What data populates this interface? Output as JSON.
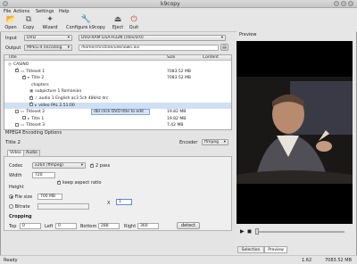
{
  "window": {
    "title": "k9copy"
  },
  "menu": [
    "File",
    "Actions",
    "Settings",
    "Help"
  ],
  "toolbar": [
    {
      "label": "Open",
      "icon": "folder-open-icon",
      "glyph": "📂"
    },
    {
      "label": "Copy",
      "icon": "copy-icon",
      "glyph": "⧉"
    },
    {
      "label": "Wizard",
      "icon": "wizard-icon",
      "glyph": "✦"
    },
    {
      "label": "Configure k9copy",
      "icon": "configure-icon",
      "glyph": "🔧"
    },
    {
      "label": "Eject",
      "icon": "eject-icon",
      "glyph": "⏏"
    },
    {
      "label": "Quit",
      "icon": "quit-icon",
      "glyph": "⏻"
    }
  ],
  "input": {
    "label": "Input",
    "type": "DVD",
    "device": "DVD-RAM GSA-H32N  (/dev/sr0)"
  },
  "output": {
    "label": "Output",
    "format": "MPEG-4 encoding",
    "path": "/home/christine/unknown.avi"
  },
  "tree": {
    "headers": [
      "Title",
      "Size",
      "Content"
    ],
    "rows": [
      {
        "text": "CASINO",
        "size": "",
        "level": 0,
        "check": false,
        "icon": "disc-icon"
      },
      {
        "text": "Titleset 1",
        "size": "7083.52 MB",
        "level": 1,
        "check": true,
        "icon": "folder-icon"
      },
      {
        "text": "Title 2",
        "size": "7083.52 MB",
        "level": 2,
        "check": true,
        "icon": "video-icon"
      },
      {
        "text": "chapters",
        "size": "",
        "level": 3,
        "check": false,
        "icon": ""
      },
      {
        "text": "subpicture 1 Romanian",
        "size": "",
        "level": 3,
        "check": false,
        "icon": "subtitle-icon"
      },
      {
        "text": "audio 1 English ac3 5ch 48kHz drc",
        "size": "",
        "level": 3,
        "check": true,
        "icon": "audio-icon"
      },
      {
        "text": "video PAL    2.51:00",
        "size": "",
        "level": 3,
        "check": true,
        "icon": "video-icon"
      },
      {
        "text": "Titleset 2",
        "size": "19.82 MB",
        "level": 1,
        "check": false,
        "icon": "folder-icon"
      },
      {
        "text": "Title 1",
        "size": "19.82 MB",
        "level": 2,
        "check": false,
        "icon": "video-icon"
      },
      {
        "text": "Titleset 3",
        "size": "7.42 MB",
        "level": 1,
        "check": false,
        "icon": "folder-icon"
      }
    ],
    "tooltip": "dbl click DVD title to edit"
  },
  "encoding": {
    "panel_title": "MPEG4 Encoding Options",
    "title_name": "Title 2",
    "encoder_label": "Encoder",
    "encoder": "ffmpeg",
    "tabs": [
      "Video",
      "Audio"
    ],
    "codec_label": "Codec",
    "codec": "x264 (ffmpeg)",
    "two_pass": "2 pass",
    "width_label": "Width",
    "width": "720",
    "keep_aspect": "keep aspect ratio",
    "height_label": "Height",
    "file_size_label": "File size",
    "file_size": "700 MB",
    "bitrate_label": "Bitrate",
    "x_label": "X",
    "x_value": "1",
    "cropping_label": "Cropping",
    "top_label": "Top",
    "top": "0",
    "left_label": "Left",
    "left": "0",
    "bottom_label": "Bottom",
    "bottom": "288",
    "right_label": "Right",
    "right": "360",
    "detect_label": "detect"
  },
  "preview": {
    "title": "Preview",
    "tabs": [
      "Selection",
      "Preview"
    ]
  },
  "status": {
    "left": "Ready",
    "value1": "1.62",
    "value2": "7083.52 MB"
  }
}
